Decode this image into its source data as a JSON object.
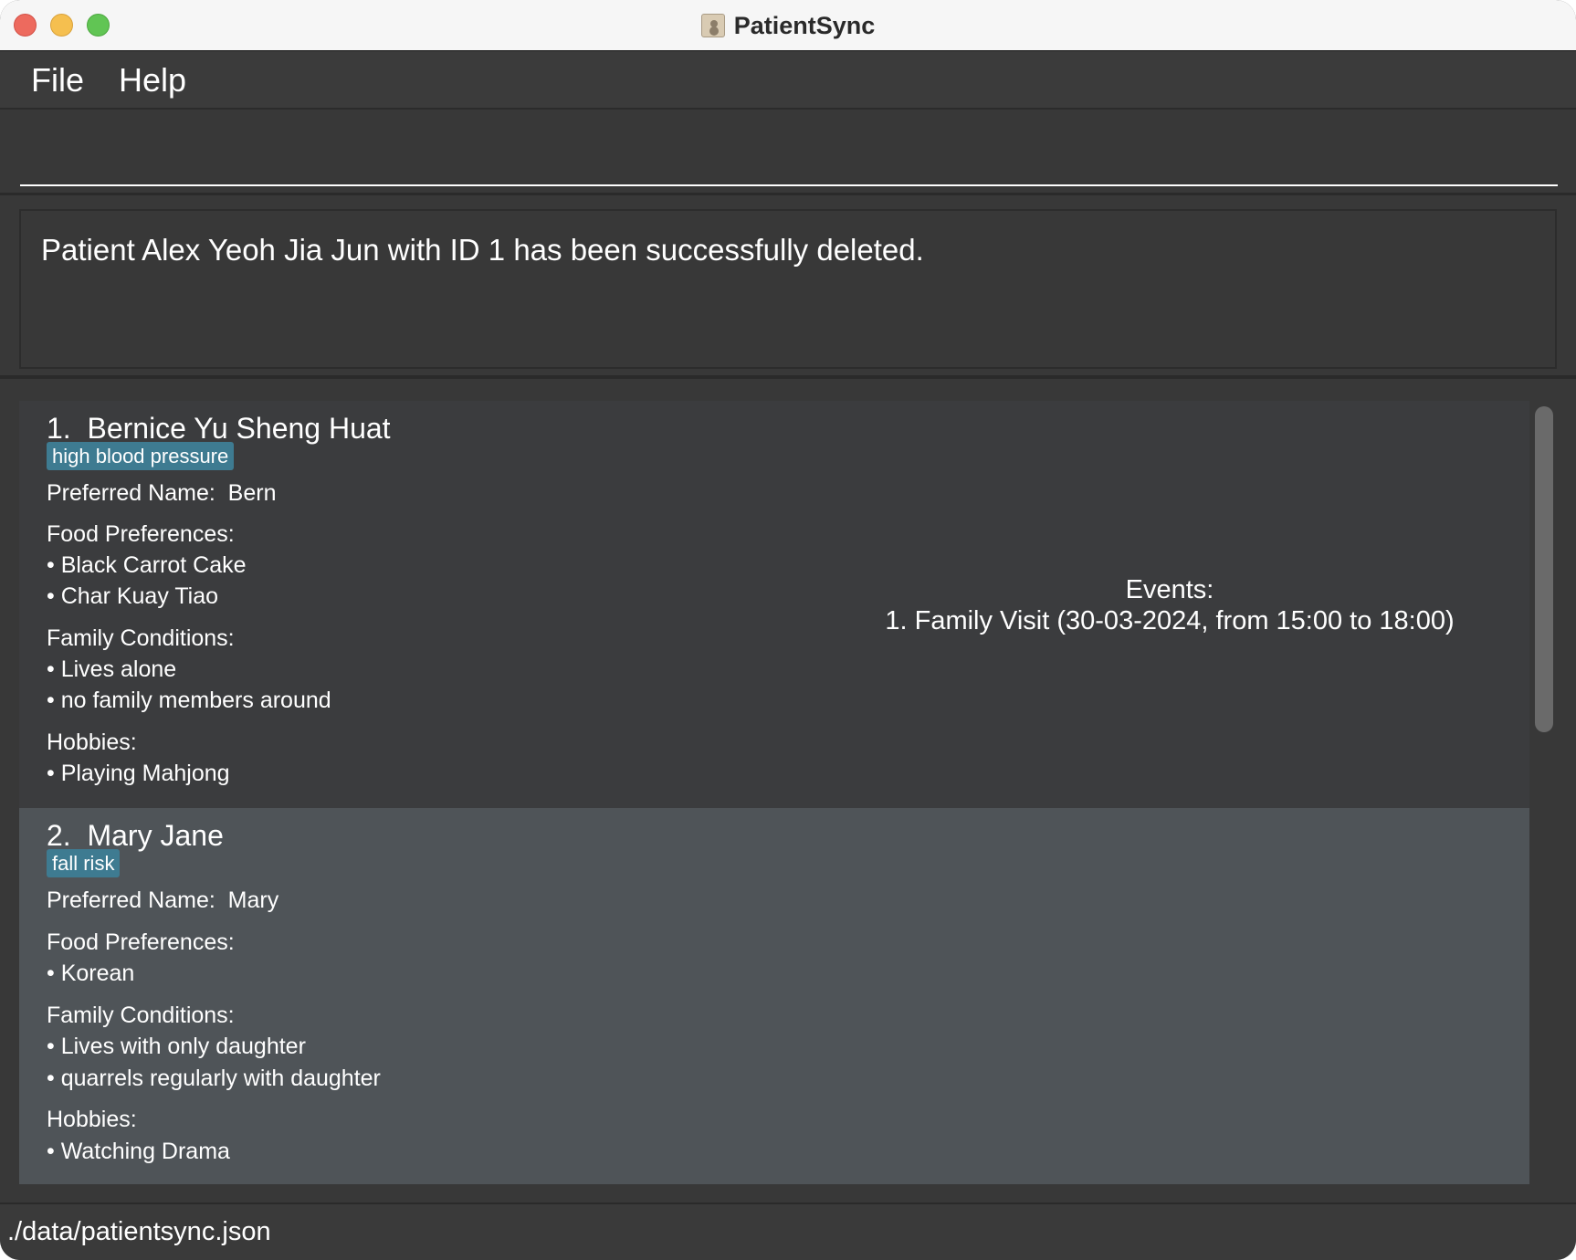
{
  "window": {
    "title": "PatientSync",
    "icon": "address-book-icon"
  },
  "menu": {
    "items": [
      {
        "label": "File"
      },
      {
        "label": "Help"
      }
    ]
  },
  "command_box": {
    "value": "",
    "placeholder": ""
  },
  "result_display": {
    "text": "Patient Alex Yeoh Jia Jun with ID 1 has been successfully deleted."
  },
  "patients": [
    {
      "header": "1.  Bernice Yu Sheng Huat",
      "tags": [
        "high blood pressure"
      ],
      "preferred_name": "Preferred Name:  Bern",
      "food_label": "Food Preferences:",
      "food": [
        "Black Carrot Cake",
        "Char Kuay Tiao"
      ],
      "family_label": "Family Conditions:",
      "family": [
        "Lives alone",
        "no family members around"
      ],
      "hobbies_label": "Hobbies:",
      "hobbies": [
        "Playing Mahjong"
      ],
      "events_label": "Events:",
      "events": [
        "1. Family Visit (30-03-2024, from 15:00 to 18:00)"
      ]
    },
    {
      "header": "2.  Mary Jane",
      "tags": [
        "fall risk"
      ],
      "preferred_name": "Preferred Name:  Mary",
      "food_label": "Food Preferences:",
      "food": [
        "Korean"
      ],
      "family_label": "Family Conditions:",
      "family": [
        "Lives with only daughter",
        "quarrels regularly with daughter"
      ],
      "hobbies_label": "Hobbies:",
      "hobbies": [
        "Watching Drama"
      ]
    }
  ],
  "status_bar": {
    "file_path": "./data/patientsync.json"
  },
  "colors": {
    "background": "#383838",
    "card_default": "#3b3c3e",
    "card_selected": "#4f5458",
    "tag": "#3e7b91",
    "close": "#ed6a5e",
    "minimize": "#f5bf4f",
    "maximize": "#61c554"
  }
}
